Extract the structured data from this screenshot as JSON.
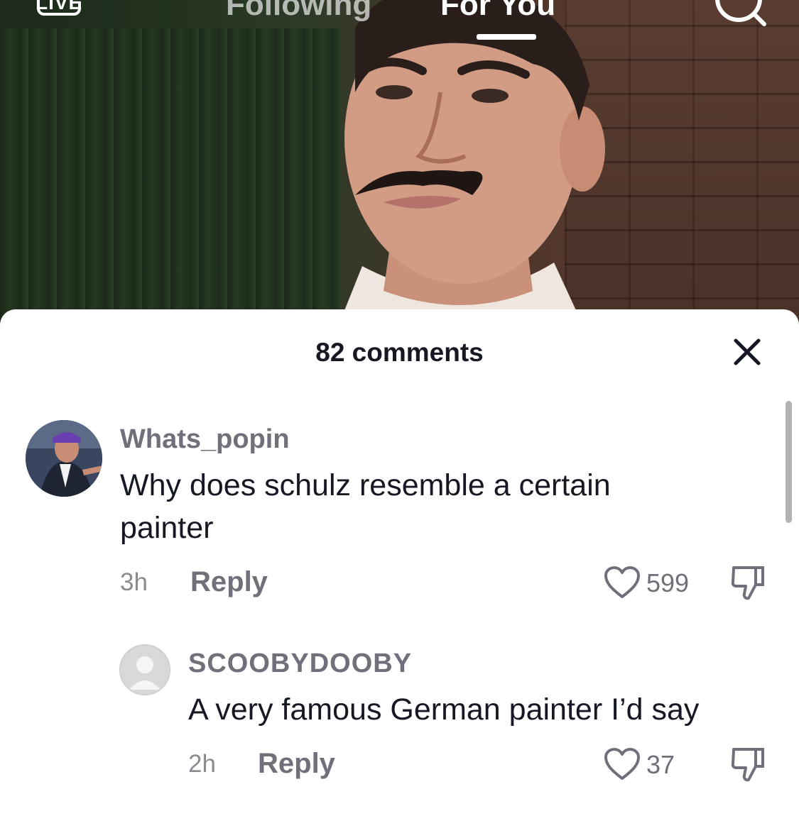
{
  "top_nav": {
    "live_label": "LIVE",
    "following_label": "Following",
    "for_you_label": "For You",
    "search_icon": "search-icon"
  },
  "comments_sheet": {
    "title": "82 comments",
    "close_icon": "close-icon",
    "comments": [
      {
        "username": "Whats_popin",
        "text": "Why does schulz resemble a certain painter",
        "time": "3h",
        "reply_label": "Reply",
        "likes": "599",
        "like_icon": "heart-icon",
        "dislike_icon": "thumbs-down-icon"
      },
      {
        "username": "SCOOBYDOOBY",
        "text": "A very famous German painter I’d say",
        "time": "2h",
        "reply_label": "Reply",
        "likes": "37",
        "like_icon": "heart-icon",
        "dislike_icon": "thumbs-down-icon"
      }
    ]
  },
  "colors": {
    "sheet_background": "#ffffff",
    "primary_text": "#161823",
    "secondary_text": "#6f7079",
    "muted_text": "#8a8b91"
  }
}
